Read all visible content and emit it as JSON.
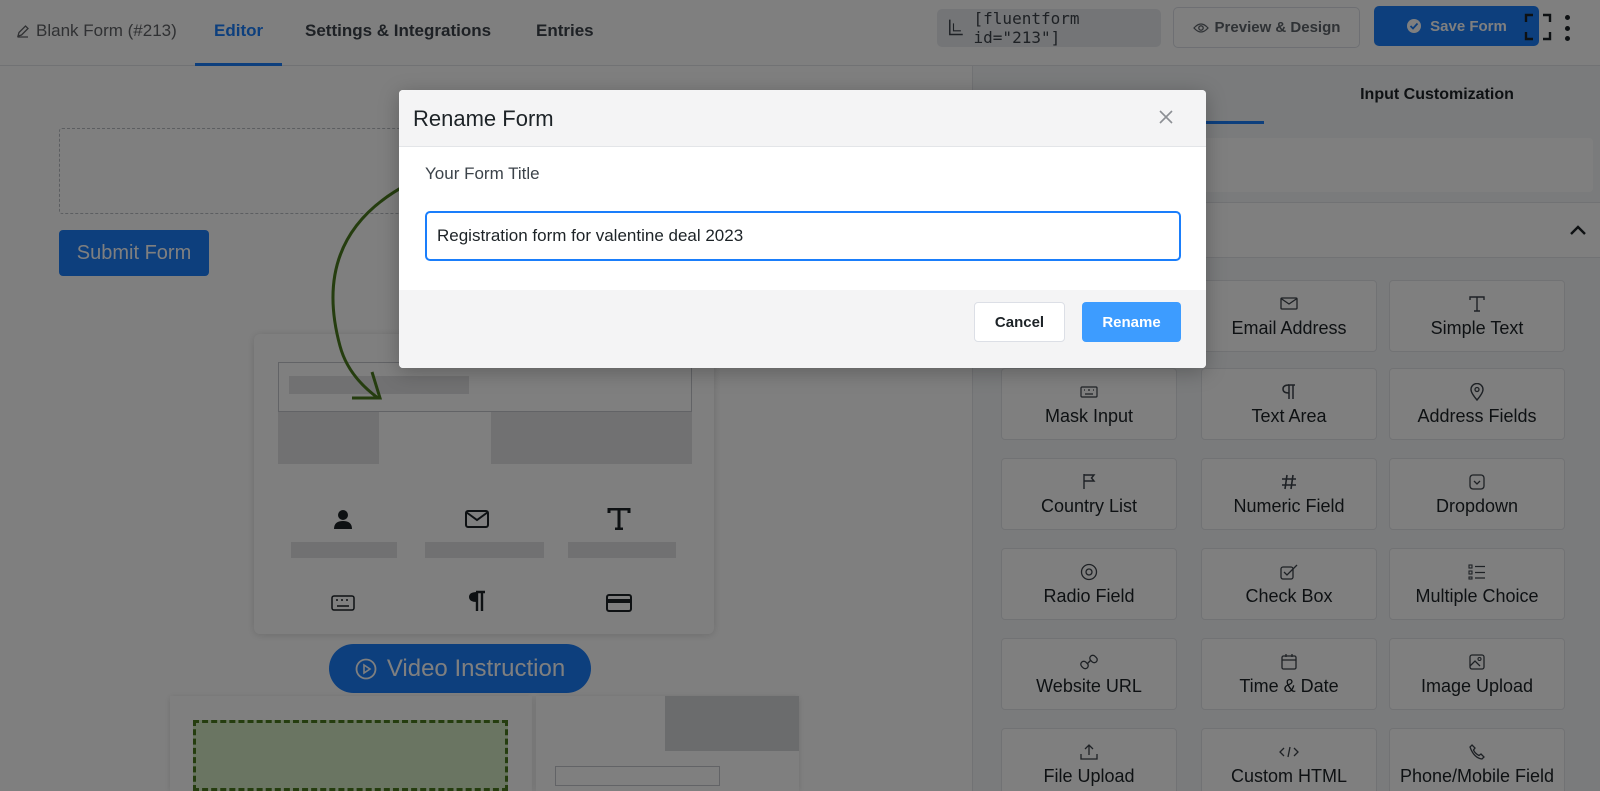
{
  "header": {
    "form_name": "Blank Form (#213)",
    "tabs": [
      {
        "label": "Editor",
        "active": true
      },
      {
        "label": "Settings & Integrations",
        "active": false
      },
      {
        "label": "Entries",
        "active": false
      }
    ],
    "shortcode": "[fluentform id=\"213\"]",
    "preview_label": "Preview & Design",
    "save_label": "Save Form"
  },
  "editor": {
    "submit_label": "Submit Form",
    "video_label": "Video Instruction"
  },
  "sidebar": {
    "tabs": [
      {
        "label": "",
        "active": true
      },
      {
        "label": "Input Customization",
        "active": false
      }
    ],
    "fields": [
      {
        "label": "Email Address",
        "icon": "envelope-icon"
      },
      {
        "label": "Simple Text",
        "icon": "text-icon"
      },
      {
        "label": "Mask Input",
        "icon": "keyboard-icon"
      },
      {
        "label": "Text Area",
        "icon": "paragraph-icon"
      },
      {
        "label": "Address Fields",
        "icon": "map-pin-icon"
      },
      {
        "label": "Country List",
        "icon": "flag-icon"
      },
      {
        "label": "Numeric Field",
        "icon": "hash-icon"
      },
      {
        "label": "Dropdown",
        "icon": "dropdown-icon"
      },
      {
        "label": "Radio Field",
        "icon": "radio-icon"
      },
      {
        "label": "Check Box",
        "icon": "checkbox-icon"
      },
      {
        "label": "Multiple Choice",
        "icon": "list-icon"
      },
      {
        "label": "Website URL",
        "icon": "link-icon"
      },
      {
        "label": "Time & Date",
        "icon": "calendar-icon"
      },
      {
        "label": "Image Upload",
        "icon": "image-icon"
      },
      {
        "label": "File Upload",
        "icon": "upload-icon"
      },
      {
        "label": "Custom HTML",
        "icon": "code-icon"
      },
      {
        "label": "Phone/Mobile Field",
        "icon": "phone-icon"
      }
    ]
  },
  "modal": {
    "title": "Rename Form",
    "field_label": "Your Form Title",
    "input_value": "Registration form for valentine deal 2023",
    "cancel_label": "Cancel",
    "rename_label": "Rename"
  },
  "colors": {
    "primary": "#1a7efb",
    "rename_button": "#3d9cff",
    "overlay": "rgba(0,0,0,0.5)",
    "illustration_arrow": "#4a7a1e"
  }
}
